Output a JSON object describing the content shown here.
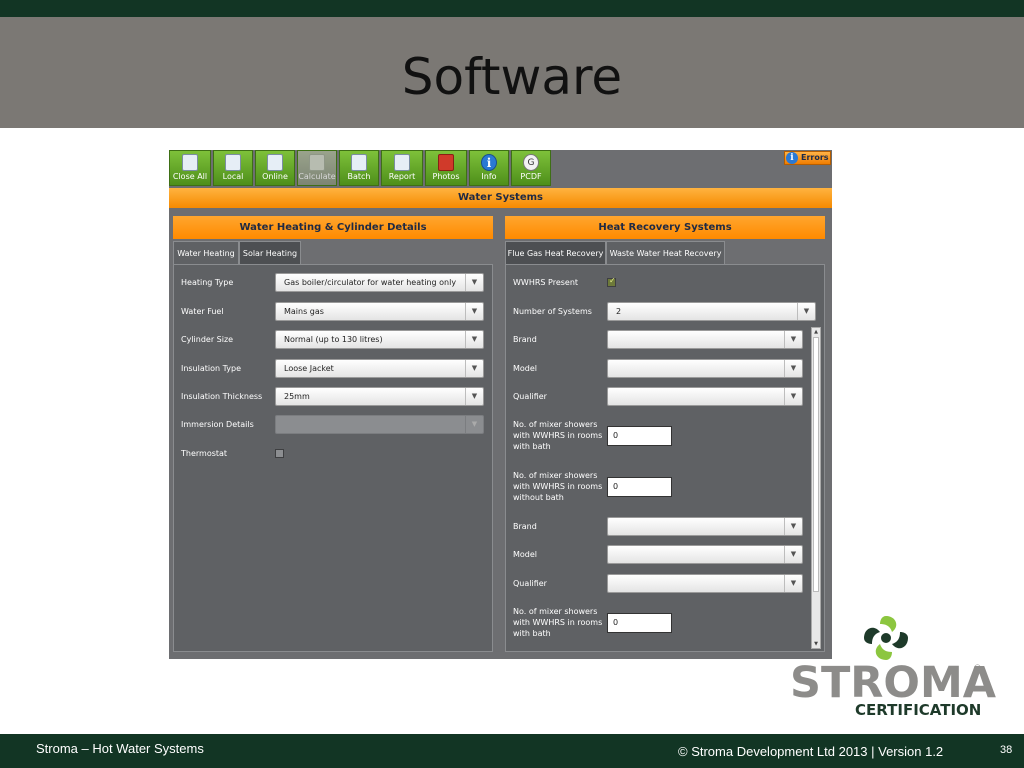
{
  "slide": {
    "title": "Software",
    "footer_left": "Stroma – Hot Water Systems",
    "footer_right": "© Stroma Development Ltd 2013  |   Version 1.2",
    "page_number": "38"
  },
  "logo": {
    "word": "STROMA",
    "registered": "®",
    "subtitle": "CERTIFICATION"
  },
  "colors": {
    "dark_green": "#123524",
    "title_band": "#7b7874",
    "toolbar_green": "#6aab2c",
    "orange": "#ff8a00",
    "panel_grey": "#5f6164"
  },
  "toolbar": {
    "buttons": [
      {
        "label": "Close All",
        "icon": "close-all-icon",
        "enabled": true
      },
      {
        "label": "Local",
        "icon": "save-local-icon",
        "enabled": true
      },
      {
        "label": "Online",
        "icon": "save-online-icon",
        "enabled": true
      },
      {
        "label": "Calculate",
        "icon": "calculator-icon",
        "enabled": false
      },
      {
        "label": "Batch",
        "icon": "batch-icon",
        "enabled": true
      },
      {
        "label": "Report",
        "icon": "report-icon",
        "enabled": true
      },
      {
        "label": "Photos",
        "icon": "photos-icon",
        "enabled": true
      },
      {
        "label": "Info",
        "icon": "info-icon",
        "enabled": true
      },
      {
        "label": "PCDF",
        "icon": "pcdf-icon",
        "enabled": true
      }
    ],
    "errors_label": "Errors",
    "info_glyph": "i",
    "pcdf_glyph": "G"
  },
  "section_title": "Water Systems",
  "left_panel": {
    "header": "Water Heating & Cylinder Details",
    "tabs": [
      {
        "label": "Water Heating",
        "active": true
      },
      {
        "label": "Solar Heating",
        "active": false
      }
    ],
    "fields": [
      {
        "label": "Heating Type",
        "value": "Gas boiler/circulator for water heating only"
      },
      {
        "label": "Water Fuel",
        "value": "Mains gas"
      },
      {
        "label": "Cylinder Size",
        "value": "Normal (up to 130 litres)"
      },
      {
        "label": "Insulation Type",
        "value": "Loose Jacket"
      },
      {
        "label": "Insulation Thickness",
        "value": "25mm"
      },
      {
        "label": "Immersion Details",
        "value": ""
      },
      {
        "label": "Thermostat",
        "checked": false
      }
    ]
  },
  "right_panel": {
    "header": "Heat Recovery Systems",
    "tabs": [
      {
        "label": "Flue Gas Heat Recovery",
        "active": false
      },
      {
        "label": "Waste Water Heat Recovery",
        "active": true
      }
    ],
    "wwhrs_present_label": "WWHRS Present",
    "wwhrs_present_checked": true,
    "number_of_systems_label": "Number of Systems",
    "number_of_systems_value": "2",
    "system1": {
      "brand_label": "Brand",
      "model_label": "Model",
      "qualifier_label": "Qualifier",
      "showers_with_bath_label": "No. of mixer showers with WWHRS in rooms with bath",
      "showers_with_bath_value": "0",
      "showers_without_bath_label": "No. of mixer showers with WWHRS in rooms without bath",
      "showers_without_bath_value": "0"
    },
    "system2": {
      "brand_label": "Brand",
      "model_label": "Model",
      "qualifier_label": "Qualifier",
      "showers_with_bath_label": "No. of mixer showers with WWHRS in rooms with bath",
      "showers_with_bath_value": "0"
    }
  },
  "glyphs": {
    "dropdown_arrow": "▼",
    "scroll_up": "▲",
    "scroll_down": "▼",
    "check": "✓"
  }
}
